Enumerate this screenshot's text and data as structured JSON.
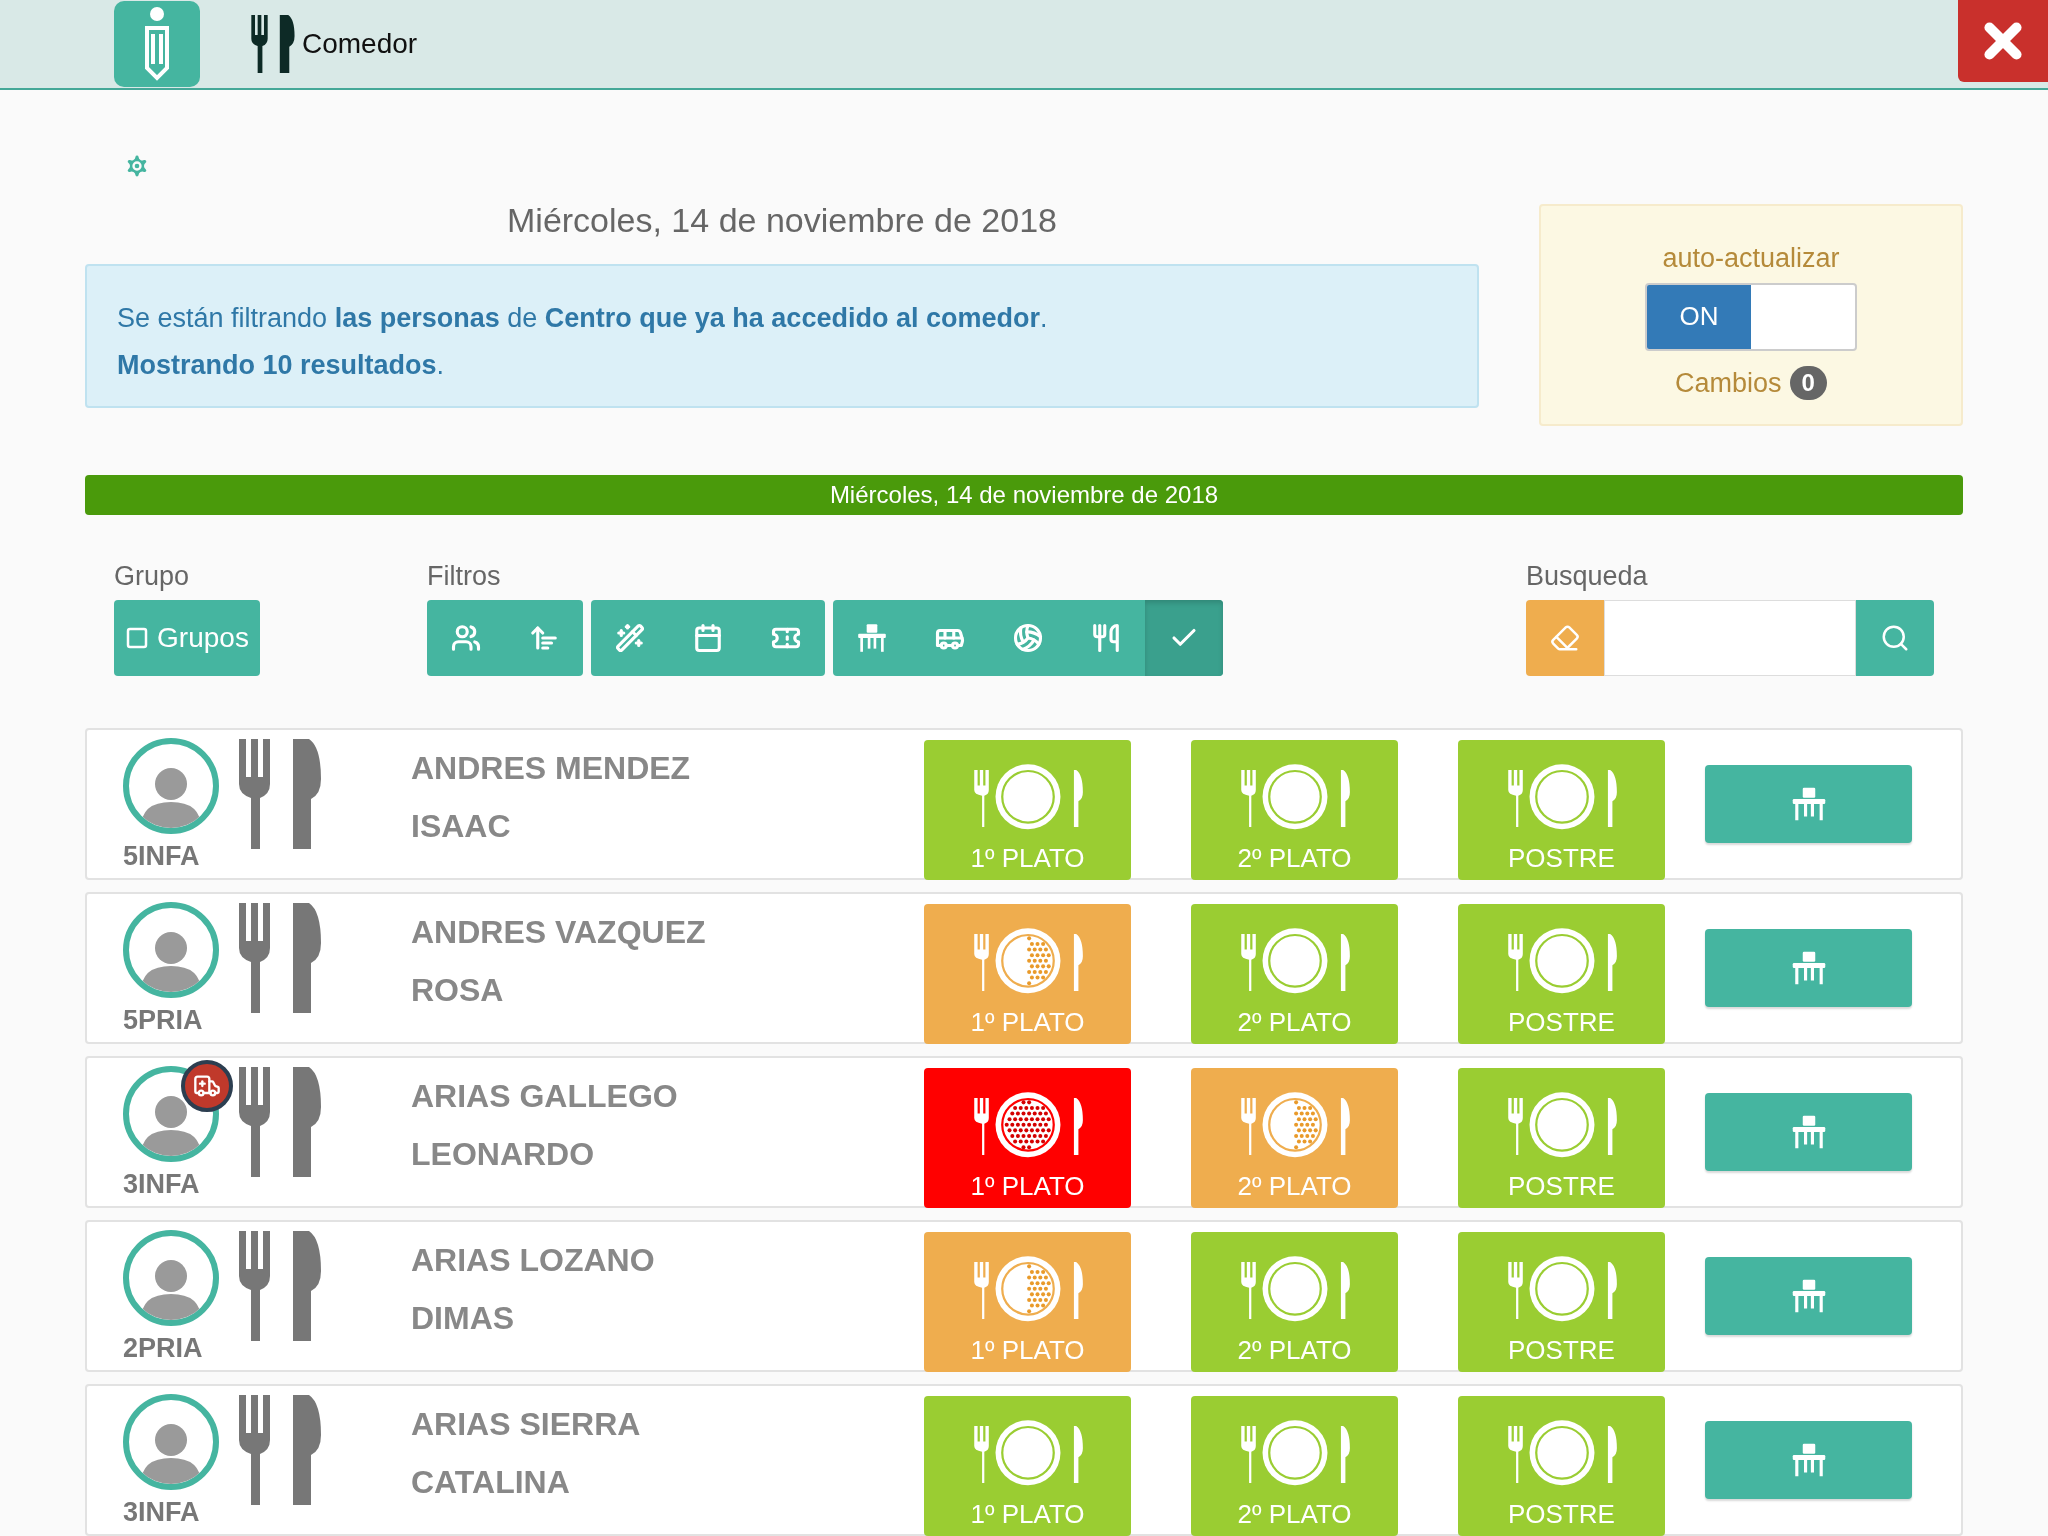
{
  "header": {
    "title": "Comedor"
  },
  "date_title": "Miércoles, 14 de noviembre de 2018",
  "info": [
    "Se están filtrando **las personas** de **Centro** **que ya ha accedido al comedor**.",
    "**Mostrando 10 resultados**."
  ],
  "auto_update": {
    "label": "auto-actualizar",
    "on": true,
    "on_label": "ON",
    "changes_label": "Cambios",
    "changes_count": "0"
  },
  "date_bar": "Miércoles, 14 de noviembre de 2018",
  "group": {
    "label": "Grupo",
    "button": "Grupos"
  },
  "filters": {
    "label": "Filtros",
    "groups": [
      [
        {
          "selected": false
        },
        {
          "selected": false
        }
      ],
      [
        {
          "selected": false
        },
        {
          "selected": false
        },
        {
          "selected": false
        }
      ],
      [
        {
          "selected": false
        },
        {
          "selected": false
        },
        {
          "selected": false
        },
        {
          "selected": false
        },
        {
          "selected": true
        }
      ]
    ]
  },
  "search": {
    "label": "Busqueda"
  },
  "rows": [
    {
      "surname": "ANDRES MENDEZ",
      "name": "ISAAC",
      "group": "5INFA",
      "alert": false,
      "meals": [
        {
          "label": "1º PLATO",
          "kind": "eaten"
        },
        {
          "label": "2º PLATO",
          "kind": "eaten"
        },
        {
          "label": "POSTRE",
          "kind": "eaten"
        }
      ]
    },
    {
      "surname": "ANDRES VAZQUEZ",
      "name": "ROSA",
      "group": "5PRIA",
      "alert": false,
      "meals": [
        {
          "label": "1º PLATO",
          "kind": "partial"
        },
        {
          "label": "2º PLATO",
          "kind": "eaten"
        },
        {
          "label": "POSTRE",
          "kind": "eaten"
        }
      ]
    },
    {
      "surname": "ARIAS GALLEGO",
      "name": "LEONARDO",
      "group": "3INFA",
      "alert": true,
      "meals": [
        {
          "label": "1º PLATO",
          "kind": "untouched"
        },
        {
          "label": "2º PLATO",
          "kind": "partial"
        },
        {
          "label": "POSTRE",
          "kind": "eaten"
        }
      ]
    },
    {
      "surname": "ARIAS LOZANO",
      "name": "DIMAS",
      "group": "2PRIA",
      "alert": false,
      "meals": [
        {
          "label": "1º PLATO",
          "kind": "partial"
        },
        {
          "label": "2º PLATO",
          "kind": "eaten"
        },
        {
          "label": "POSTRE",
          "kind": "eaten"
        }
      ]
    },
    {
      "surname": "ARIAS SIERRA",
      "name": "CATALINA",
      "group": "3INFA",
      "alert": false,
      "meals": [
        {
          "label": "1º PLATO",
          "kind": "eaten"
        },
        {
          "label": "2º PLATO",
          "kind": "eaten"
        },
        {
          "label": "POSTRE",
          "kind": "eaten"
        }
      ]
    }
  ]
}
